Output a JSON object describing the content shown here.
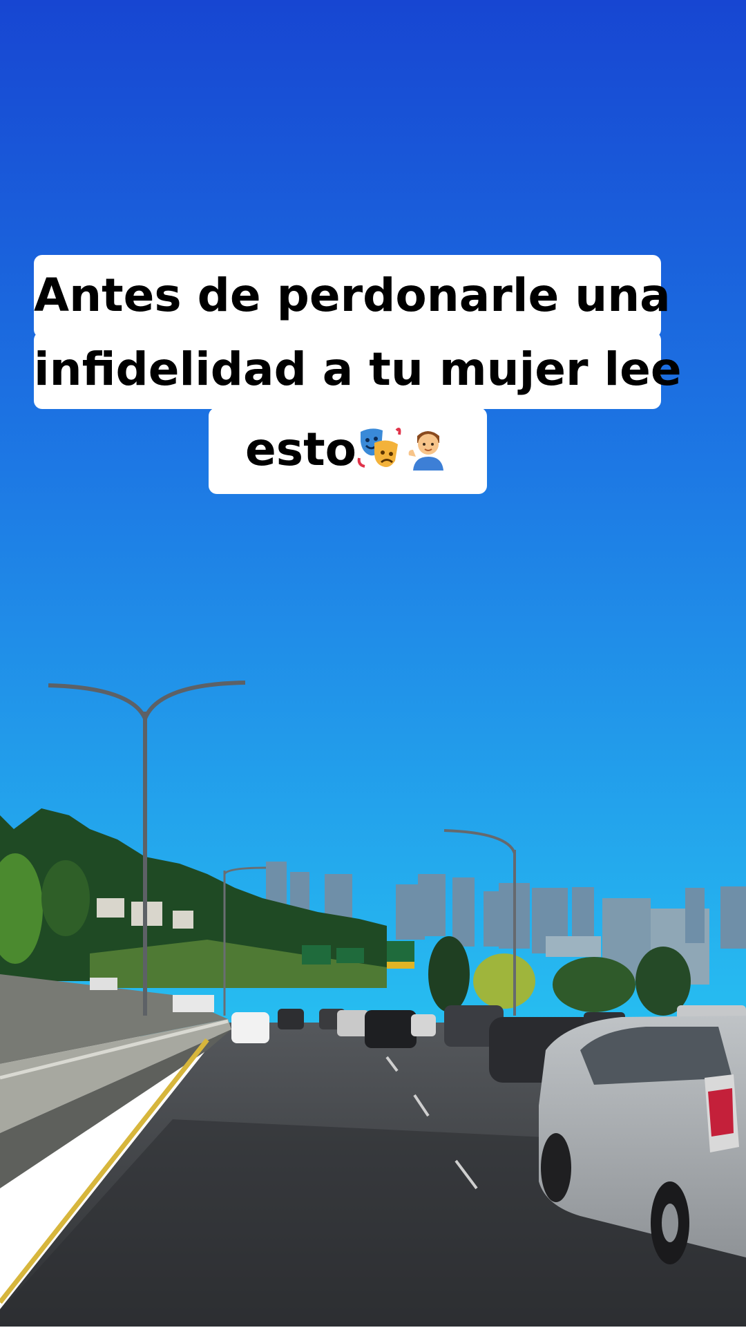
{
  "caption": {
    "line1": "Antes de perdonarle una",
    "line2": "infidelidad a tu mujer lee",
    "line3": "esto",
    "emojis": [
      "performing-arts-icon",
      "man-tipping-hand-icon"
    ]
  },
  "colors": {
    "sky_top": "#1a55d8",
    "sky_bottom": "#22b6ee",
    "road": "#3f4246",
    "lane_yellow": "#d7b63c",
    "caption_bg": "#ffffff",
    "caption_text": "#000000"
  }
}
